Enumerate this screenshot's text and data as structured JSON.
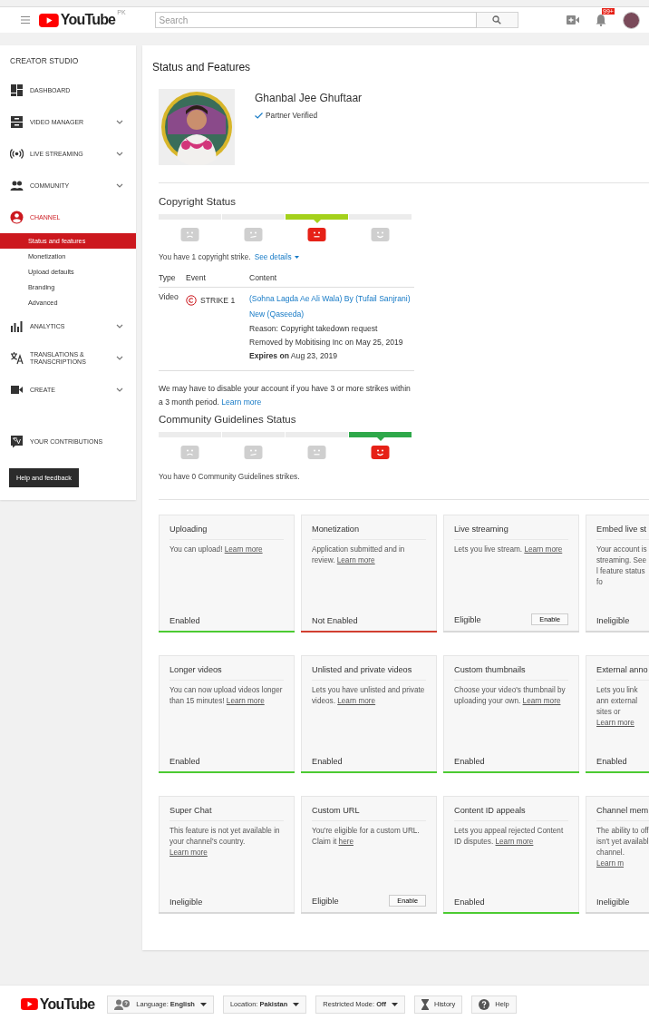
{
  "header": {
    "logo": "YouTube",
    "region": "PK",
    "search": {
      "placeholder": "Search"
    },
    "notifications": "99+"
  },
  "sidebar": {
    "title": "CREATOR STUDIO",
    "items": [
      {
        "kind": "dashboard",
        "label": "DASHBOARD",
        "selected": false,
        "expandable": false
      },
      {
        "kind": "videos",
        "label": "VIDEO MANAGER",
        "selected": false,
        "expandable": true
      },
      {
        "kind": "live",
        "label": "LIVE STREAMING",
        "selected": false,
        "expandable": true
      },
      {
        "kind": "community",
        "label": "COMMUNITY",
        "selected": false,
        "expandable": true
      },
      {
        "kind": "channel",
        "label": "CHANNEL",
        "selected": true,
        "expandable": false,
        "children": [
          {
            "label": "Status and features",
            "selected": true
          },
          {
            "label": "Monetization",
            "selected": false
          },
          {
            "label": "Upload defaults",
            "selected": false
          },
          {
            "label": "Branding",
            "selected": false
          },
          {
            "label": "Advanced",
            "selected": false
          }
        ]
      },
      {
        "kind": "analytics",
        "label": "ANALYTICS",
        "selected": false,
        "expandable": true
      },
      {
        "kind": "translate",
        "label": "TRANSLATIONS & TRANSCRIPTIONS",
        "selected": false,
        "expandable": true
      },
      {
        "kind": "create",
        "label": "CREATE",
        "selected": false,
        "expandable": true
      }
    ],
    "contributions": {
      "kind": "contrib",
      "label": "YOUR CONTRIBUTIONS"
    },
    "help_button": "Help and feedback"
  },
  "main": {
    "title": "Status and Features",
    "channel": {
      "name": "Ghanbal Jee Ghuftaar",
      "verified": "Partner Verified"
    },
    "copyright": {
      "title": "Copyright Status",
      "color": "#a4d11b",
      "segments": [
        {
          "kind": "sad",
          "selected": false
        },
        {
          "kind": "unsure",
          "selected": false
        },
        {
          "kind": "neutral",
          "selected": true
        },
        {
          "kind": "happy",
          "selected": false
        }
      ],
      "summary": "You have 1 copyright strike.",
      "details_link": "See details",
      "table": {
        "columns": [
          "Type",
          "Event",
          "Content"
        ],
        "rows": [
          {
            "type": "Video",
            "event": "STRIKE 1",
            "title": "(Sohna Lagda Ae Ali Wala) By (Tufail Sanjrani) New (Qaseeda)",
            "lines": [
              "Reason: Copyright takedown request",
              "Removed by Mobitising Inc on May 25, 2019",
              "**Expires on** Aug 23, 2019"
            ]
          }
        ]
      },
      "warning": "We may have to disable your account if you have 3 or more strikes within a 3 month period.",
      "warning_link": "Learn more"
    },
    "community": {
      "title": "Community Guidelines Status",
      "color": "#2ea84a",
      "segments": [
        {
          "kind": "sad",
          "selected": false
        },
        {
          "kind": "unsure",
          "selected": false
        },
        {
          "kind": "neutral",
          "selected": false
        },
        {
          "kind": "happy",
          "selected": true
        }
      ],
      "summary": "You have 0 Community Guidelines strikes."
    },
    "features": [
      {
        "title": "Uploading",
        "text": "You can upload!",
        "link": "Learn more",
        "status": "Enabled",
        "kind": "enabled"
      },
      {
        "title": "Monetization",
        "text": "Application submitted and in review.",
        "link": "Learn more",
        "status": "Not Enabled",
        "kind": "disabled"
      },
      {
        "title": "Live streaming",
        "text": "Lets you live stream.",
        "link": "Learn more",
        "status": "Eligible",
        "kind": "none",
        "button": "Enable"
      },
      {
        "title": "Embed live st",
        "text": "Your account is streaming. See l feature status fo",
        "status": "Ineligible",
        "kind": "none"
      },
      {
        "title": "Longer videos",
        "text": "You can now upload videos longer than 15 minutes!",
        "link": "Learn more",
        "status": "Enabled",
        "kind": "enabled"
      },
      {
        "title": "Unlisted and private videos",
        "text": "Lets you have unlisted and private videos.",
        "link": "Learn more",
        "status": "Enabled",
        "kind": "enabled"
      },
      {
        "title": "Custom thumbnails",
        "text": "Choose your video's thumbnail by uploading your own.",
        "link": "Learn more",
        "status": "Enabled",
        "kind": "enabled"
      },
      {
        "title": "External anno",
        "text": "Lets you link ann external sites or",
        "link": "Learn more",
        "status": "Enabled",
        "kind": "enabled"
      },
      {
        "title": "Super Chat",
        "text": "This feature is not yet available in your channel's country.",
        "link": "Learn more",
        "status": "Ineligible",
        "kind": "none"
      },
      {
        "title": "Custom URL",
        "text": "You're eligible for a custom URL. Claim it",
        "link": "here",
        "status": "Eligible",
        "kind": "none",
        "button": "Enable"
      },
      {
        "title": "Content ID appeals",
        "text": "Lets you appeal rejected Content ID disputes.",
        "link": "Learn more",
        "status": "Enabled",
        "kind": "enabled"
      },
      {
        "title": "Channel mem",
        "text": "The ability to off isn't yet availabl channel.",
        "link": "Learn m",
        "status": "Ineligible",
        "kind": "none"
      }
    ]
  },
  "footer": {
    "logo": "YouTube",
    "buttons": [
      {
        "kind": "language",
        "label": "Language: **English**"
      },
      {
        "kind": "location",
        "label": "Location: **Pakistan**"
      },
      {
        "kind": "restricted",
        "label": "Restricted Mode: **Off**"
      },
      {
        "kind": "history",
        "label": "History"
      },
      {
        "kind": "help",
        "label": "Help"
      }
    ]
  }
}
